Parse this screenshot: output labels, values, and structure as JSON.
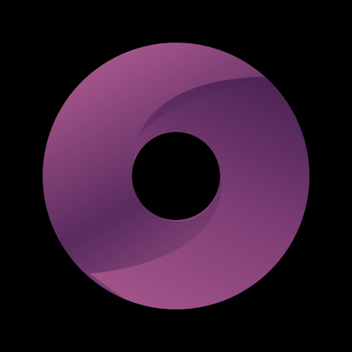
{
  "icon": {
    "name": "purple-ring-swirl-icon",
    "shape": "ring-with-inner-swirl"
  },
  "colors": {
    "background": "#000000",
    "ring_light": "#a5568c",
    "ring_mid": "#7e3e75",
    "ring_dark": "#4f2556",
    "hole": "#000000"
  }
}
